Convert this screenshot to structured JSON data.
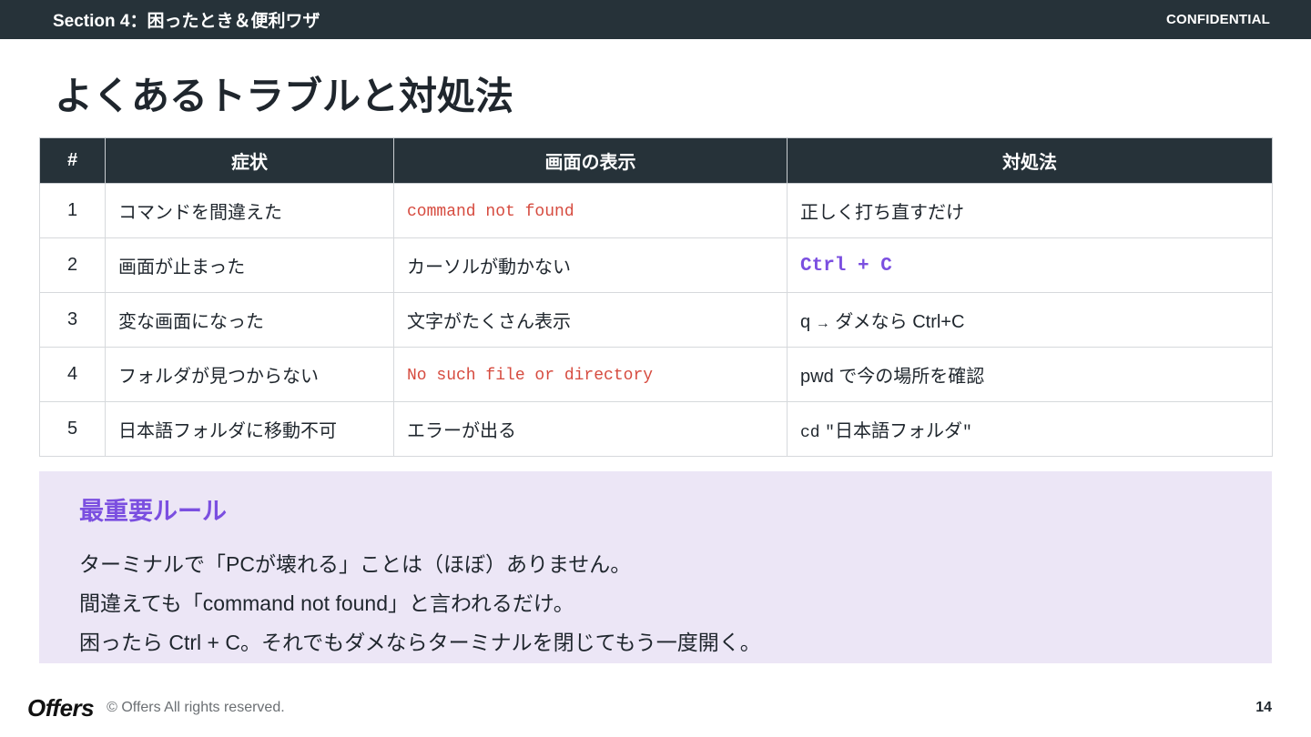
{
  "header": {
    "section": "Section 4：困ったとき＆便利ワザ",
    "confidential": "CONFIDENTIAL"
  },
  "title": "よくあるトラブルと対処法",
  "table": {
    "columns": [
      "#",
      "症状",
      "画面の表示",
      "対処法"
    ],
    "rows": [
      {
        "num": "1",
        "symptom": "コマンドを間違えた",
        "display": "command not found",
        "fix": "正しく打ち直すだけ"
      },
      {
        "num": "2",
        "symptom": "画面が止まった",
        "display": "カーソルが動かない",
        "fix": "Ctrl + C"
      },
      {
        "num": "3",
        "symptom": "変な画面になった",
        "display": "文字がたくさん表示",
        "fix_q": "q",
        "fix_arrow": "→",
        "fix_rest": "ダメなら Ctrl+C"
      },
      {
        "num": "4",
        "symptom": "フォルダが見つからない",
        "display": "No such file or directory",
        "fix": "pwd で今の場所を確認"
      },
      {
        "num": "5",
        "symptom": "日本語フォルダに移動不可",
        "display": "エラーが出る",
        "fix_cmd": "cd",
        "fix_quote_open": "\"",
        "fix_folder": "日本語フォルダ",
        "fix_quote_close": "\""
      }
    ]
  },
  "rule": {
    "title": "最重要ルール",
    "lines": [
      "ターミナルで「PCが壊れる」ことは（ほぼ）ありません。",
      "間違えても「command not found」と言われるだけ。",
      "困ったら Ctrl + C。それでもダメならターミナルを閉じてもう一度開く。"
    ]
  },
  "footer": {
    "logo": "Offers",
    "copyright": "© Offers All rights reserved.",
    "page": "14"
  },
  "colors": {
    "dark": "#263239",
    "accent": "#7b4fe0",
    "error": "#d64b3f",
    "rule_bg": "#ece6f6"
  }
}
